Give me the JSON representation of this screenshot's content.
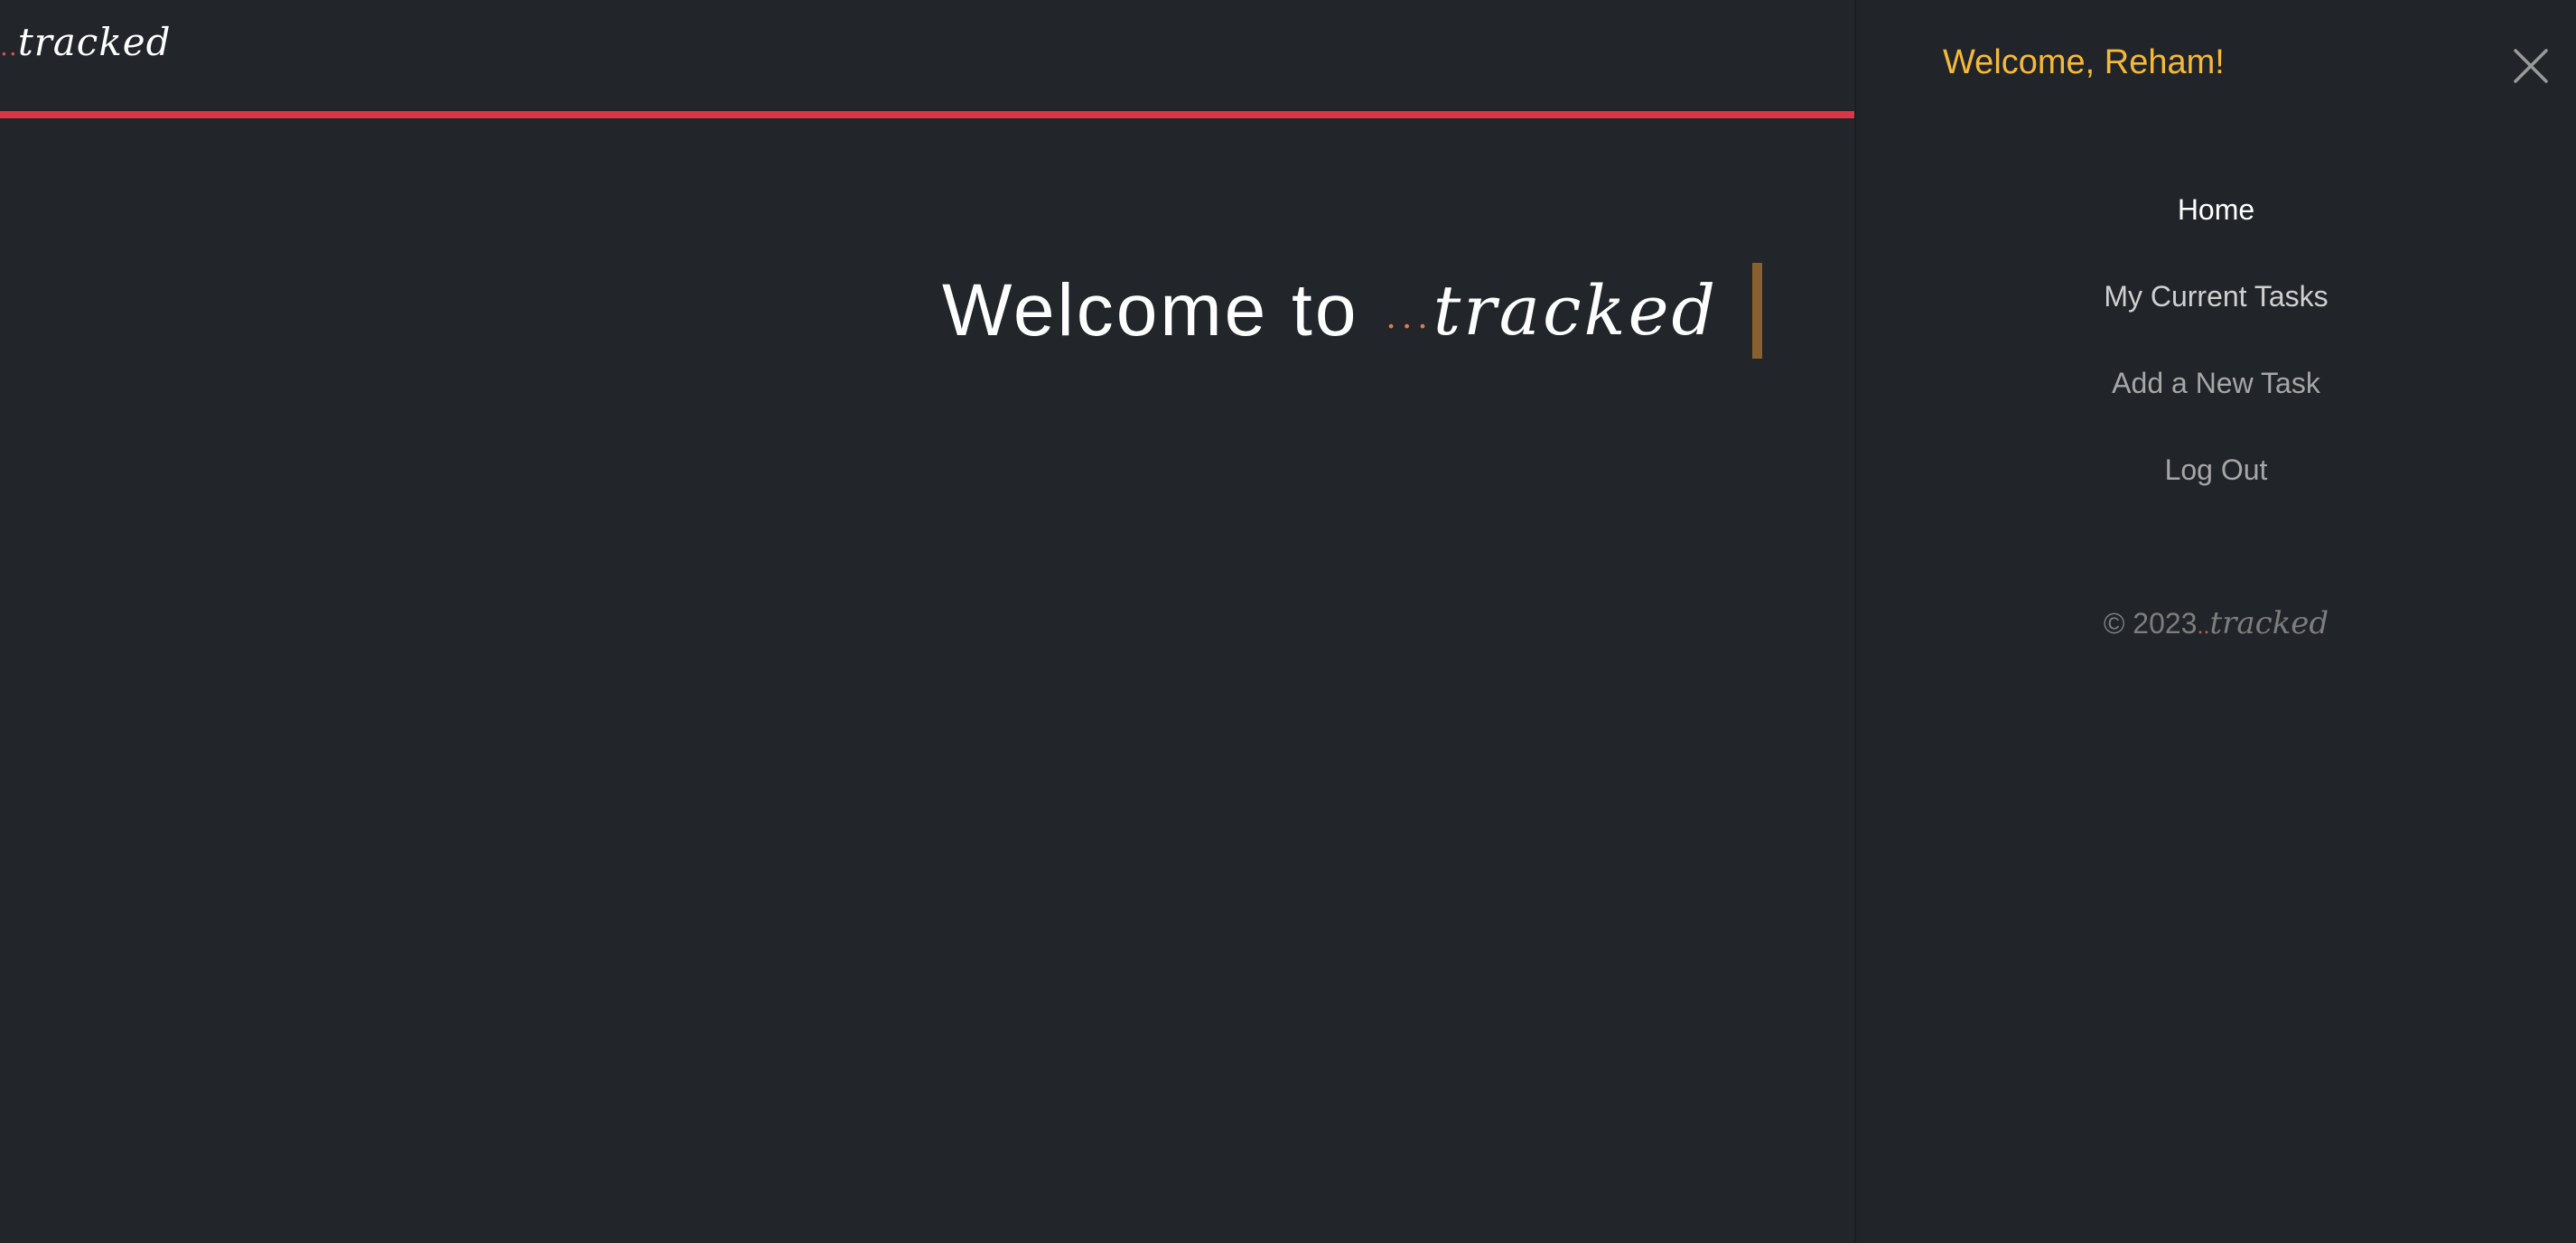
{
  "brand": {
    "dots": "..",
    "word": "tracked",
    "accent_color": "#dc3545"
  },
  "hero": {
    "prefix": "Welcome to",
    "dots": "...",
    "word": "tracked",
    "cursor_color": "#8a6030"
  },
  "sidebar": {
    "greeting": "Welcome, Reham!",
    "greeting_color": "#f5b93a",
    "close_icon": "close-icon",
    "items": [
      {
        "label": "Home"
      },
      {
        "label": "My Current Tasks"
      },
      {
        "label": "Add a New Task"
      },
      {
        "label": "Log Out"
      }
    ],
    "footer": {
      "copyright": "© 2023",
      "dots": "..",
      "word": "tracked"
    }
  }
}
